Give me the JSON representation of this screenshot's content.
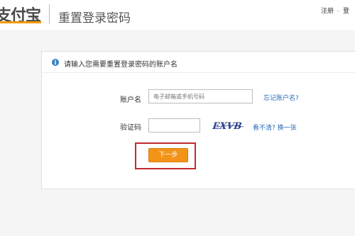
{
  "header": {
    "logo_text": "支付宝",
    "page_title": "重置登录密码",
    "links": {
      "register": "注册",
      "separator": "-",
      "login": "登"
    }
  },
  "notice": {
    "icon": "info-icon",
    "text": "请输入您需要重置登录密码的账户名"
  },
  "form": {
    "account_label": "账户名",
    "account_placeholder": "电子邮箱或手机号码",
    "forgot_link": "忘记账户名?",
    "captcha_label": "验证码",
    "captcha_value": "",
    "captcha_image_text": "EXVB",
    "refresh_link": "看不清? 换一张",
    "next_button": "下一步"
  },
  "colors": {
    "accent_orange": "#f39318",
    "link_blue": "#2a6bb8",
    "highlight_red": "#c3282f",
    "info_blue": "#3b7fc4"
  }
}
